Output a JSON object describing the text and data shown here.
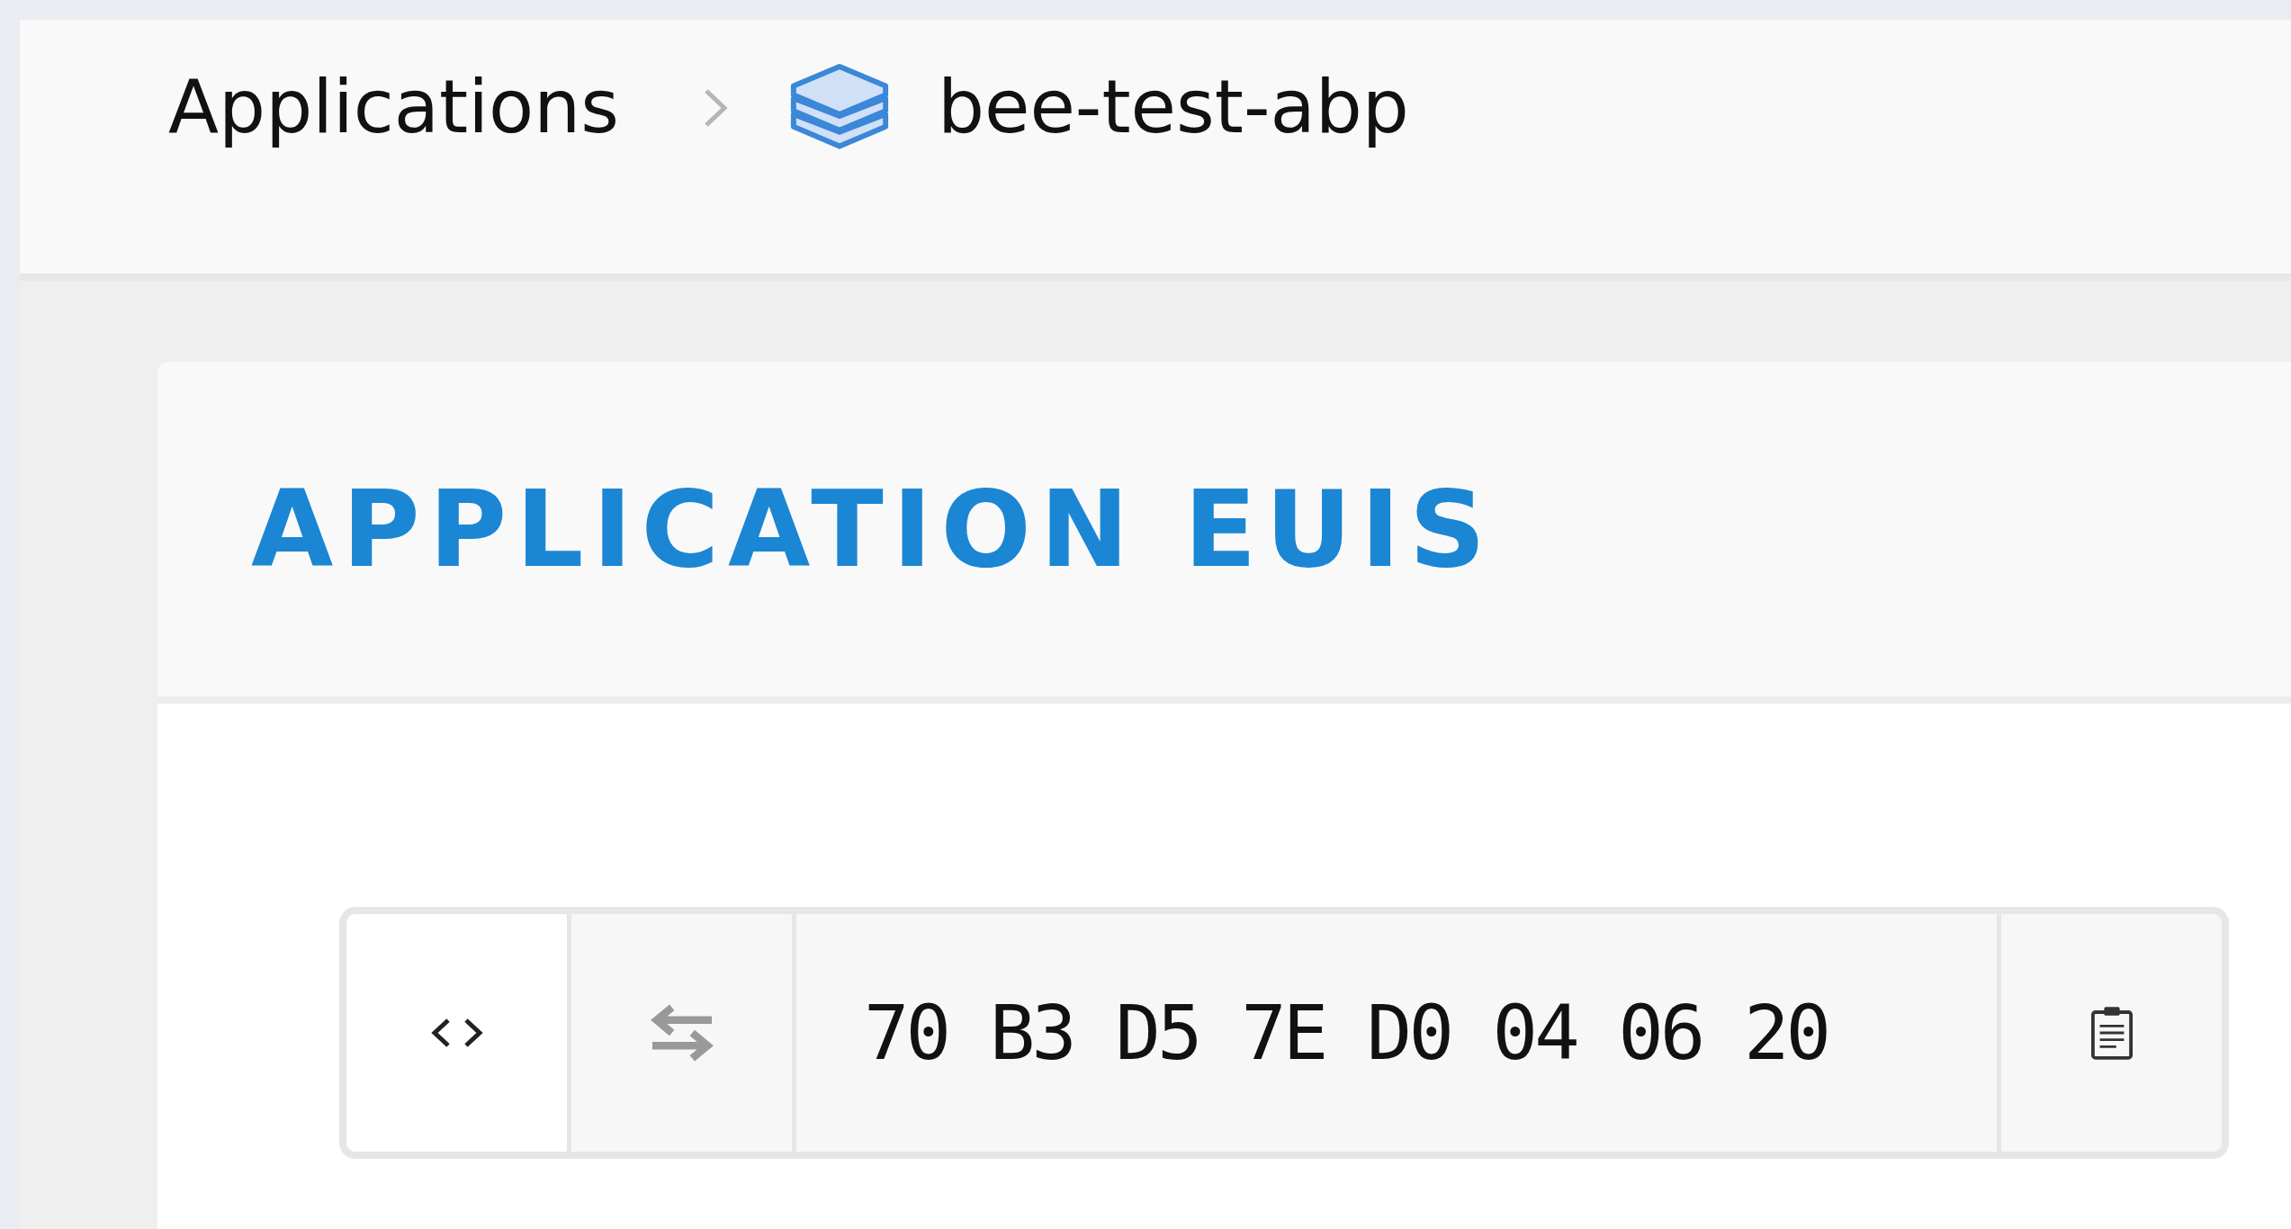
{
  "breadcrumb": [
    {
      "label": "Applications",
      "kind": "link"
    },
    {
      "label": "bee-test-abp",
      "kind": "app"
    }
  ],
  "card": {
    "title": "APPLICATION EUIS"
  },
  "eui_field": {
    "value": "70 B3 D5 7E D0 04 06 20"
  }
}
